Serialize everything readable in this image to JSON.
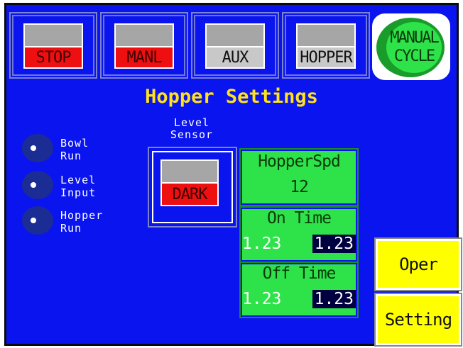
{
  "top_buttons": [
    {
      "label": "STOP"
    },
    {
      "label": "MANL"
    },
    {
      "label": "AUX"
    },
    {
      "label": "HOPPER"
    }
  ],
  "manual_cycle": {
    "line1": "MANUAL",
    "line2": "CYCLE"
  },
  "title": "Hopper Settings",
  "indicators": [
    {
      "label": "Bowl\nRun"
    },
    {
      "label": "Level\nInput"
    },
    {
      "label": "Hopper\nRun"
    }
  ],
  "level_sensor": {
    "title_line1": "Level",
    "title_line2": "Sensor",
    "state": "DARK"
  },
  "hopper_speed": {
    "label": "HopperSpd",
    "value": "12"
  },
  "on_time": {
    "label": "On Time",
    "actual": "1.23",
    "setpoint": "1.23"
  },
  "off_time": {
    "label": "Off Time",
    "actual": "1.23",
    "setpoint": "1.23"
  },
  "side_buttons": {
    "oper": "Oper",
    "setting": "Setting"
  },
  "colors": {
    "background": "#0a14ee",
    "title": "#ffe21c",
    "green": "#2ee34a",
    "yellow": "#ffff00",
    "red": "#ee1010"
  }
}
